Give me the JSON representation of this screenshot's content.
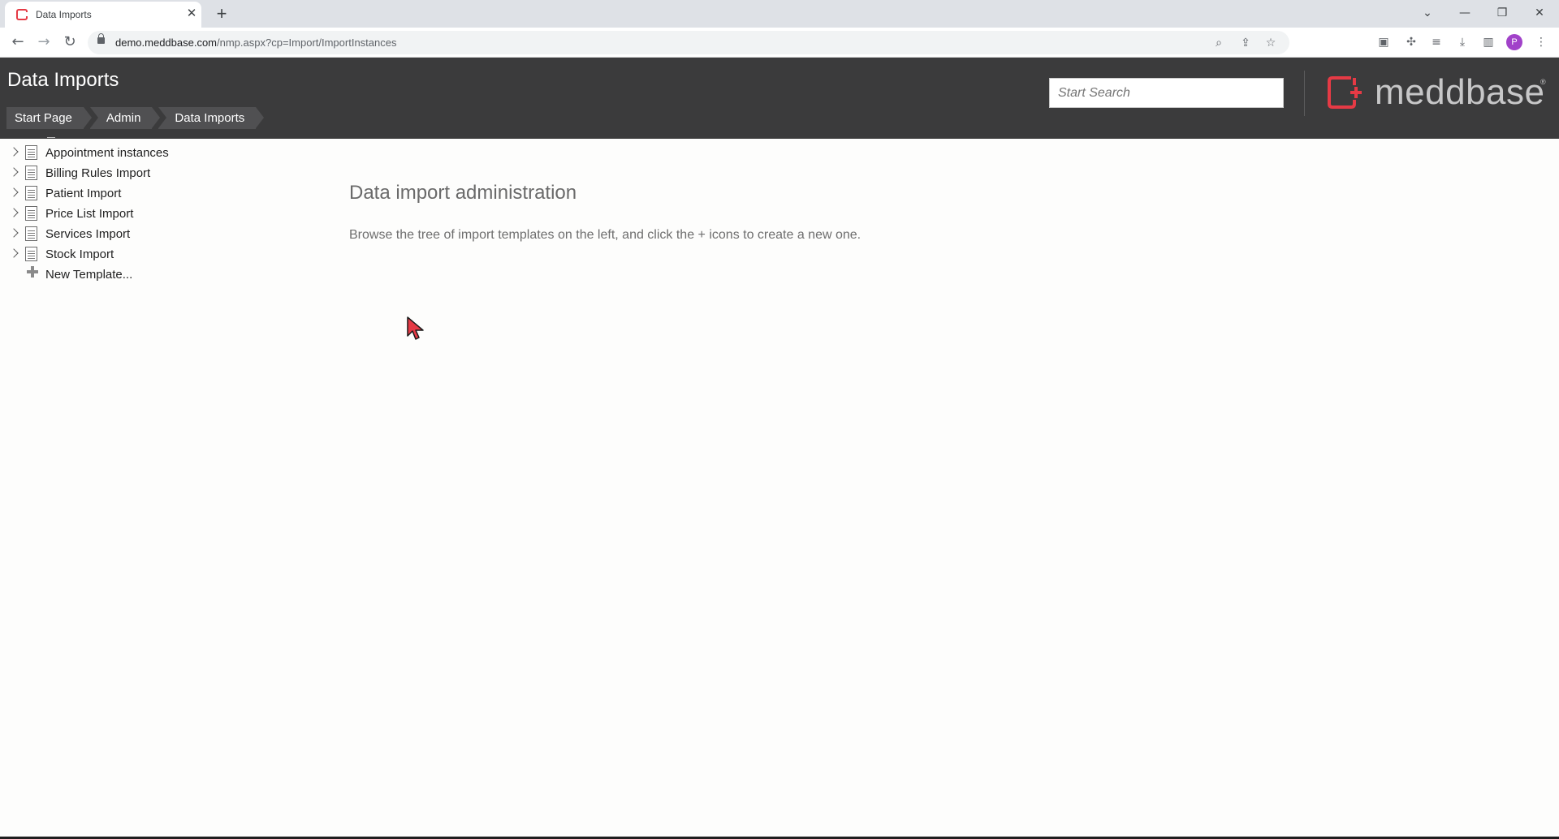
{
  "browser": {
    "tab_title": "Data Imports",
    "tab_close": "✕",
    "new_tab": "+",
    "url_host": "demo.meddbase.com",
    "url_path": "/nmp.aspx?cp=Import/ImportInstances",
    "profile_initial": "P",
    "window_controls": {
      "tab_search": "⌄",
      "minimize": "—",
      "restore": "❐",
      "close": "✕"
    }
  },
  "header": {
    "title": "Data Imports",
    "breadcrumb": [
      "Start Page",
      "Admin",
      "Data Imports"
    ],
    "search_placeholder": "Start Search",
    "logo_text": "meddbase",
    "logo_reg": "®",
    "brand_color": "#e53a45"
  },
  "tree": {
    "items": [
      {
        "label": "Appointment instances"
      },
      {
        "label": "Billing Rules Import"
      },
      {
        "label": "Patient Import"
      },
      {
        "label": "Price List Import"
      },
      {
        "label": "Services Import"
      },
      {
        "label": "Stock Import"
      }
    ],
    "new_template_label": "New Template..."
  },
  "main": {
    "heading": "Data import administration",
    "description": "Browse the tree of import templates on the left, and click the + icons to create a new one."
  }
}
